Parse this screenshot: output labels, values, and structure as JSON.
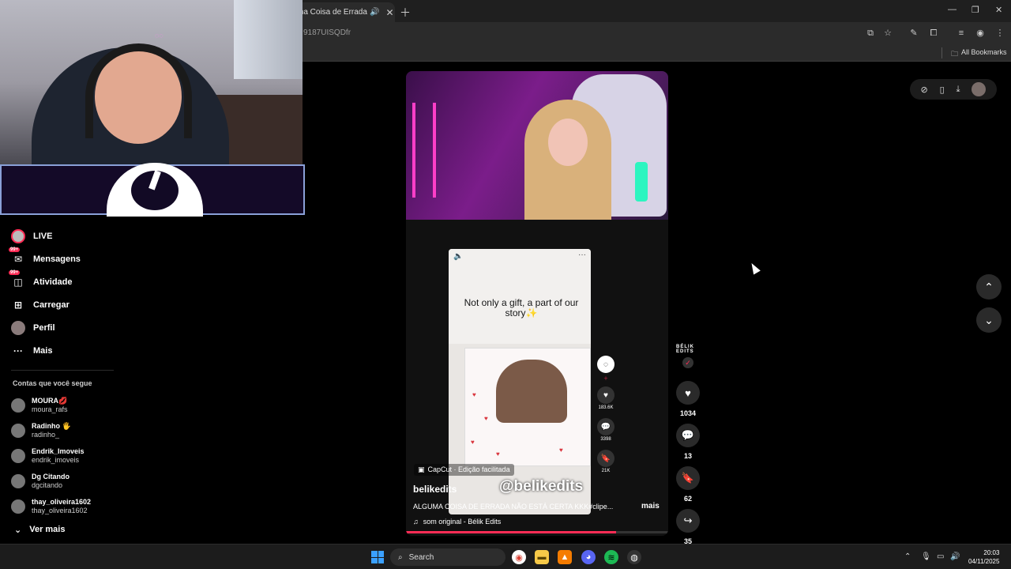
{
  "browser": {
    "tab_title": "ma Coisa de Errada Nã",
    "url_visible": "9187UISQDfr",
    "bookmarks_label": "All Bookmarks"
  },
  "sidebar": {
    "items": [
      {
        "label": "LIVE",
        "icon": "live-avatar"
      },
      {
        "label": "Mensagens",
        "icon": "message-icon",
        "badge": "99+"
      },
      {
        "label": "Atividade",
        "icon": "activity-icon",
        "badge": "99+"
      },
      {
        "label": "Carregar",
        "icon": "upload-icon"
      },
      {
        "label": "Perfil",
        "icon": "profile-avatar"
      },
      {
        "label": "Mais",
        "icon": "more-icon"
      }
    ],
    "following_title": "Contas que você segue",
    "following": [
      {
        "name": "MOURA💋",
        "handle": "moura_rafs"
      },
      {
        "name": "Radinho 🖐",
        "handle": "radinho_"
      },
      {
        "name": "Endrik_Imoveis",
        "handle": "endrik_imoveis"
      },
      {
        "name": "Dg Citando",
        "handle": "dgcitando"
      },
      {
        "name": "thay_oliveira1602",
        "handle": "thay_oliveira1602"
      }
    ],
    "see_more": "Ver mais"
  },
  "video": {
    "inner_caption": "Not only a gift, a part of our story✨",
    "capcut_label": "CapCut · Edição facilitada",
    "watermark": "@belikedits",
    "author": "belikedits",
    "caption": "ALGUMA COISA DE ERRADA NÃO ESTÁ CERTA KKK#clipe...",
    "more": "mais",
    "sound": "som original - Bélik Edits",
    "inner_counts": {
      "likes": "183.6K",
      "comments": "3398",
      "saves": "21K"
    },
    "progress_fraction": 0.8
  },
  "actions": {
    "logo_text": "BÉLIK EDITS",
    "likes": "1034",
    "comments": "13",
    "saves": "62",
    "shares": "35"
  },
  "taskbar": {
    "search_placeholder": "Search",
    "time": "20:03",
    "date": "04/11/2025"
  }
}
